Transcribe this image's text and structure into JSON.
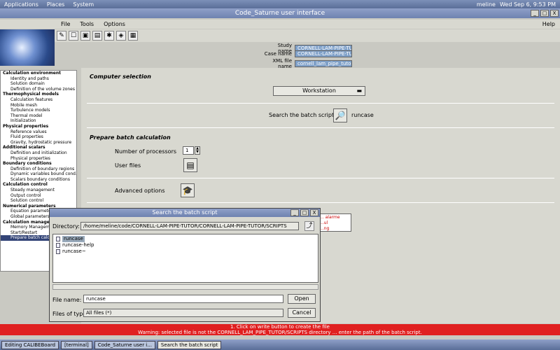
{
  "top_panel": {
    "menus": [
      "Applications",
      "Places",
      "System"
    ],
    "user": "meline",
    "clock": "Wed Sep 6, 9:53 PM"
  },
  "window": {
    "title": "Code_Saturne user interface",
    "min": "_",
    "max": "□",
    "close": "X"
  },
  "menubar": {
    "file": "File",
    "tools": "Tools",
    "options": "Options",
    "help": "Help"
  },
  "info": {
    "study_label": "Study name",
    "study_value": "CORNELL-LAM-PIPE-TUTOR",
    "case_label": "Case name",
    "case_value": "CORNELL-LAM-PIPE-TUTOR",
    "xml_label": "XML file name",
    "xml_value": "cornell_lam_pipe_tutor.xml"
  },
  "tree": [
    {
      "label": "Calculation environment",
      "children": [
        "Identity and paths",
        "Solution domain",
        "Definition of the volume zones"
      ]
    },
    {
      "label": "Thermophysical models",
      "children": [
        "Calculation features",
        "Mobile mesh",
        "Turbulence models",
        "Thermal model",
        "Initialization"
      ]
    },
    {
      "label": "Physical properties",
      "children": [
        "Reference values",
        "Fluid properties",
        "Gravity, hydrostatic pressure"
      ]
    },
    {
      "label": "Additional scalars",
      "children": [
        "Definition and initialization",
        "Physical properties"
      ]
    },
    {
      "label": "Boundary conditions",
      "children": [
        "Definition of boundary regions",
        "Dynamic variables bound cond.",
        "Scalars boundary conditions"
      ]
    },
    {
      "label": "Calculation control",
      "children": [
        "Steady management",
        "Output control",
        "Solution control"
      ]
    },
    {
      "label": "Numerical parameters",
      "children": [
        "Equation parameters",
        "Global parameters"
      ]
    },
    {
      "label": "Calculation management",
      "children": [
        "Memory Management",
        "Start/Restart",
        "Prepare batch calculation"
      ]
    }
  ],
  "main": {
    "computer_header": "Computer selection",
    "workstation": "Workstation",
    "search_label": "Search the batch script file",
    "script_name": "runcase",
    "prepare_header": "Prepare batch calculation",
    "nproc_label": "Number of processors",
    "nproc_value": "1",
    "userfiles_label": "User files",
    "advanced_label": "Advanced options",
    "hidden_warning_line1": "... alarme",
    "hidden_warning_line2": "...ul",
    "hidden_warning_line3": "...ng"
  },
  "status_bar": {
    "line1": "1. Click on write button to create the file",
    "line2": "Warning: selected file is not the CORNELL_LAM_PIPE_TUTOR/SCRIPTS directory ... enter the path of the batch script."
  },
  "dialog": {
    "title": "Search the batch script",
    "directory_label": "Directory:",
    "directory_value": "/home/meline/code/CORNELL-LAM-PIPE-TUTOR/CORNELL-LAM-PIPE-TUTOR/SCRIPTS",
    "files": [
      "runcase",
      "runcase-help",
      "runcase~"
    ],
    "filename_label": "File name:",
    "filename_value": "runcase",
    "filetype_label": "Files of type:",
    "filetype_value": "All files (*)",
    "open": "Open",
    "cancel": "Cancel"
  },
  "taskbar": [
    "Editing CALIBEBoard",
    "[terminal]",
    "Code_Saturne user i...",
    "Search the batch script"
  ]
}
